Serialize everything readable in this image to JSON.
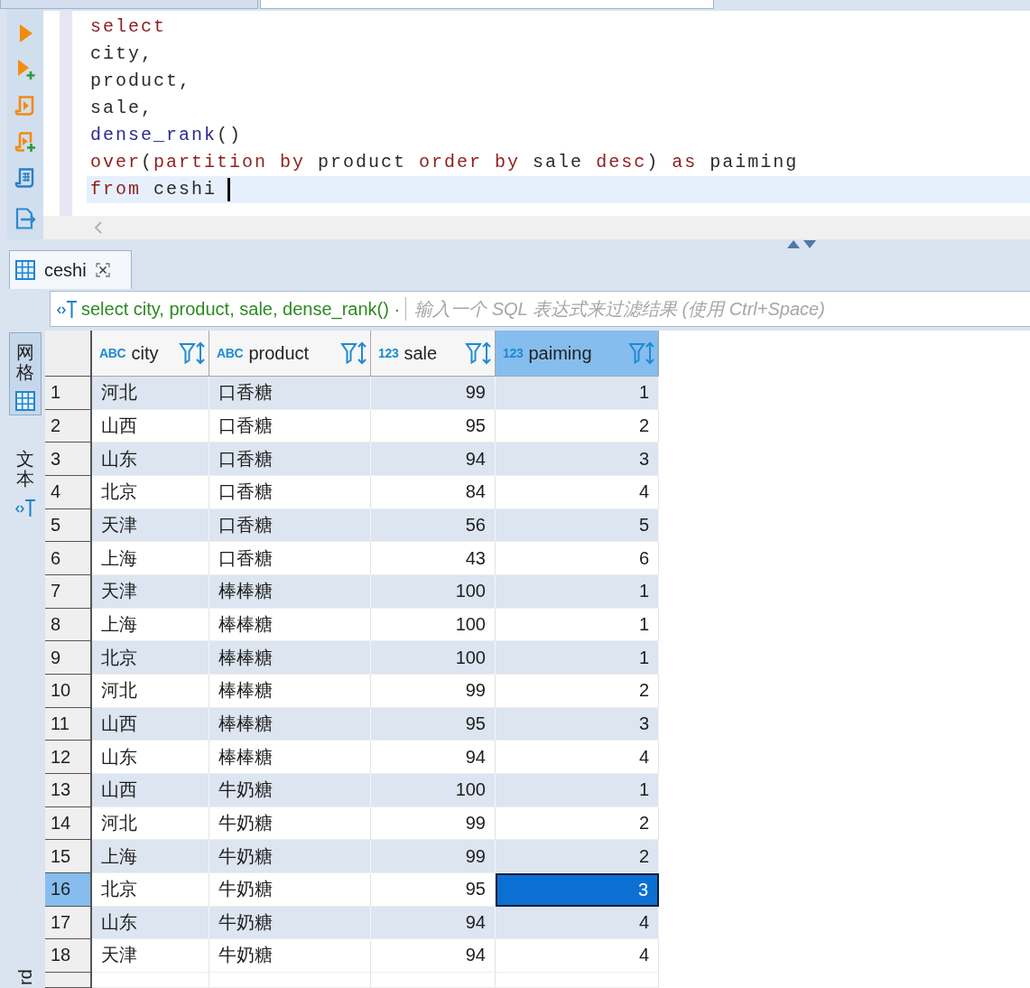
{
  "editor": {
    "lines": [
      {
        "tokens": [
          {
            "text": "select",
            "kind": "keyword"
          }
        ],
        "current": false
      },
      {
        "tokens": [
          {
            "text": "city,",
            "kind": "plain"
          }
        ],
        "current": false
      },
      {
        "tokens": [
          {
            "text": "product,",
            "kind": "plain"
          }
        ],
        "current": false
      },
      {
        "tokens": [
          {
            "text": "sale,",
            "kind": "plain"
          }
        ],
        "current": false
      },
      {
        "tokens": [
          {
            "text": "dense_rank",
            "kind": "function"
          },
          {
            "text": "()",
            "kind": "plain"
          }
        ],
        "current": false
      },
      {
        "tokens": [
          {
            "text": "over",
            "kind": "keyword"
          },
          {
            "text": "(",
            "kind": "plain"
          },
          {
            "text": "partition by",
            "kind": "keyword"
          },
          {
            "text": " product ",
            "kind": "plain"
          },
          {
            "text": "order by",
            "kind": "keyword"
          },
          {
            "text": " sale ",
            "kind": "plain"
          },
          {
            "text": "desc",
            "kind": "keyword"
          },
          {
            "text": ") ",
            "kind": "plain"
          },
          {
            "text": "as",
            "kind": "keyword"
          },
          {
            "text": " paiming",
            "kind": "plain"
          }
        ],
        "current": false
      },
      {
        "tokens": [
          {
            "text": "from",
            "kind": "keyword"
          },
          {
            "text": " ceshi",
            "kind": "plain"
          }
        ],
        "current": true
      }
    ]
  },
  "results": {
    "tabs": [
      {
        "label": "ceshi",
        "selected": true
      }
    ],
    "filter": {
      "query": "select city, product, sale, dense_rank() ·",
      "placeholder": "输入一个 SQL 表达式来过滤结果 (使用 Ctrl+Space)"
    },
    "view_tabs": [
      {
        "label": "网格",
        "kind": "grid",
        "selected": true
      },
      {
        "label": "文本",
        "kind": "text",
        "selected": false
      }
    ],
    "record_toggle": {
      "label": "rd"
    },
    "grid": {
      "columns": [
        {
          "name": "city",
          "type_label": "ABC",
          "kind": "text",
          "selected": false
        },
        {
          "name": "product",
          "type_label": "ABC",
          "kind": "text",
          "selected": false
        },
        {
          "name": "sale",
          "type_label": "123",
          "kind": "number",
          "selected": false
        },
        {
          "name": "paiming",
          "type_label": "123",
          "kind": "number",
          "selected": true
        }
      ],
      "rows": [
        {
          "number": "1",
          "cells": [
            "河北",
            "口香糖",
            "99",
            "1"
          ],
          "selected": false
        },
        {
          "number": "2",
          "cells": [
            "山西",
            "口香糖",
            "95",
            "2"
          ],
          "selected": false
        },
        {
          "number": "3",
          "cells": [
            "山东",
            "口香糖",
            "94",
            "3"
          ],
          "selected": false
        },
        {
          "number": "4",
          "cells": [
            "北京",
            "口香糖",
            "84",
            "4"
          ],
          "selected": false
        },
        {
          "number": "5",
          "cells": [
            "天津",
            "口香糖",
            "56",
            "5"
          ],
          "selected": false
        },
        {
          "number": "6",
          "cells": [
            "上海",
            "口香糖",
            "43",
            "6"
          ],
          "selected": false
        },
        {
          "number": "7",
          "cells": [
            "天津",
            "棒棒糖",
            "100",
            "1"
          ],
          "selected": false
        },
        {
          "number": "8",
          "cells": [
            "上海",
            "棒棒糖",
            "100",
            "1"
          ],
          "selected": false
        },
        {
          "number": "9",
          "cells": [
            "北京",
            "棒棒糖",
            "100",
            "1"
          ],
          "selected": false
        },
        {
          "number": "10",
          "cells": [
            "河北",
            "棒棒糖",
            "99",
            "2"
          ],
          "selected": false
        },
        {
          "number": "11",
          "cells": [
            "山西",
            "棒棒糖",
            "95",
            "3"
          ],
          "selected": false
        },
        {
          "number": "12",
          "cells": [
            "山东",
            "棒棒糖",
            "94",
            "4"
          ],
          "selected": false
        },
        {
          "number": "13",
          "cells": [
            "山西",
            "牛奶糖",
            "100",
            "1"
          ],
          "selected": false
        },
        {
          "number": "14",
          "cells": [
            "河北",
            "牛奶糖",
            "99",
            "2"
          ],
          "selected": false
        },
        {
          "number": "15",
          "cells": [
            "上海",
            "牛奶糖",
            "99",
            "2"
          ],
          "selected": false
        },
        {
          "number": "16",
          "cells": [
            "北京",
            "牛奶糖",
            "95",
            "3"
          ],
          "selected": true
        },
        {
          "number": "17",
          "cells": [
            "山东",
            "牛奶糖",
            "94",
            "4"
          ],
          "selected": false
        },
        {
          "number": "18",
          "cells": [
            "天津",
            "牛奶糖",
            "94",
            "4"
          ],
          "selected": false
        }
      ]
    }
  }
}
